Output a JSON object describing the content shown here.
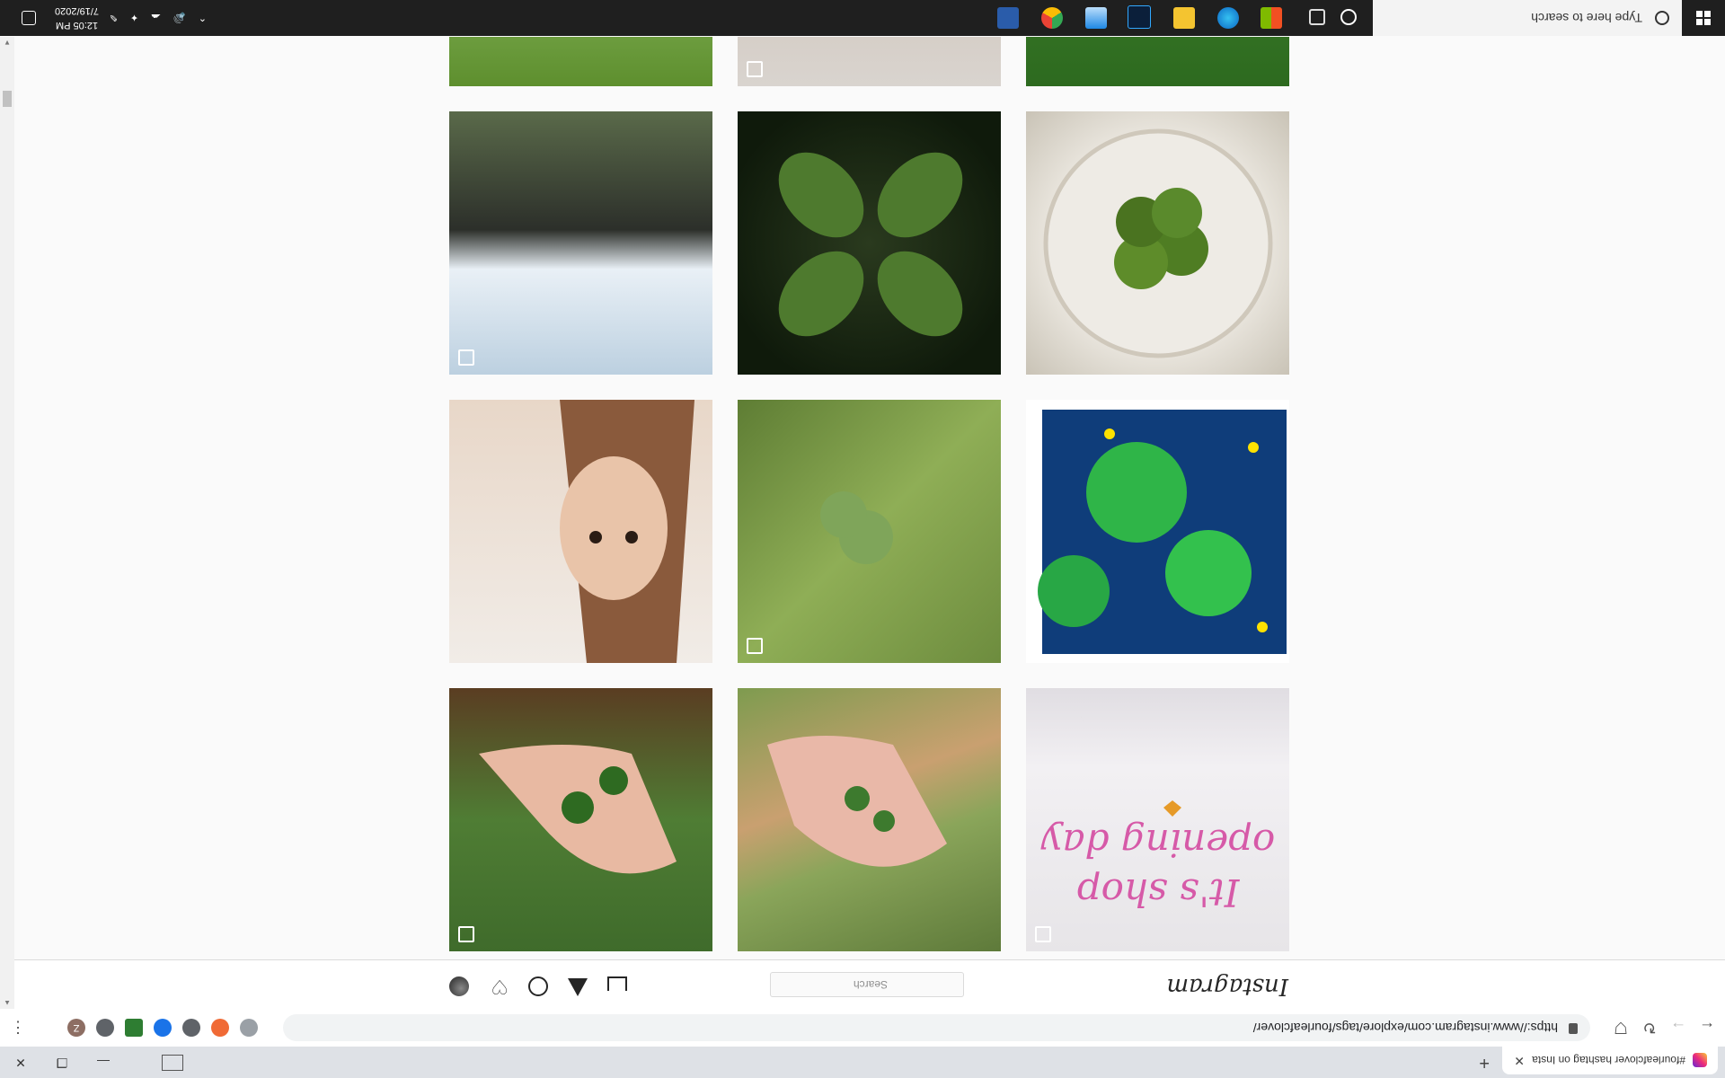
{
  "browser": {
    "tab_title": "#fourleafclover hashtag on Insta",
    "url": "https://www.instagram.com/explore/tags/fourleafclover/",
    "new_tab_icon": "plus-icon",
    "window_buttons": [
      "minimize-icon",
      "restore-icon",
      "close-icon"
    ],
    "extensions": [
      {
        "letter": "",
        "color": "#9aa0a6"
      },
      {
        "letter": "",
        "color": "#f06a35"
      },
      {
        "letter": "",
        "color": "#5f6368"
      },
      {
        "letter": "",
        "color": "#1a73e8"
      },
      {
        "letter": "",
        "color": "#2e7d32"
      },
      {
        "letter": "",
        "color": "#5f6368"
      },
      {
        "letter": "Z",
        "color": "#8d6e63"
      }
    ]
  },
  "instagram": {
    "logo": "Instagram",
    "search_placeholder": "Search",
    "nav_icons": [
      "home-icon",
      "direct-icon",
      "explore-icon",
      "activity-heart-icon",
      "profile-avatar"
    ]
  },
  "posts": [
    {
      "desc": "grass and leaves",
      "multi": false
    },
    {
      "desc": "ceramic bowl",
      "multi": true
    },
    {
      "desc": "person in grass",
      "multi": false
    },
    {
      "desc": "pressed clover in resin coaster",
      "multi": false
    },
    {
      "desc": "four leaf clover closeup",
      "multi": false
    },
    {
      "desc": "sky reflection in water",
      "multi": true
    },
    {
      "desc": "painting of clovers with yellow flowers",
      "multi": false
    },
    {
      "desc": "clover among grass",
      "multi": true
    },
    {
      "desc": "woman portrait",
      "multi": false
    },
    {
      "desc": "It's shop opening day",
      "multi": true,
      "text": "It's shop opening day"
    },
    {
      "desc": "hand holding clovers with ring",
      "multi": false
    },
    {
      "desc": "hand over clover patch",
      "multi": true
    }
  ],
  "taskbar": {
    "search_placeholder": "Type here to search",
    "time": "12:05 PM",
    "date": "7/19/2020"
  }
}
